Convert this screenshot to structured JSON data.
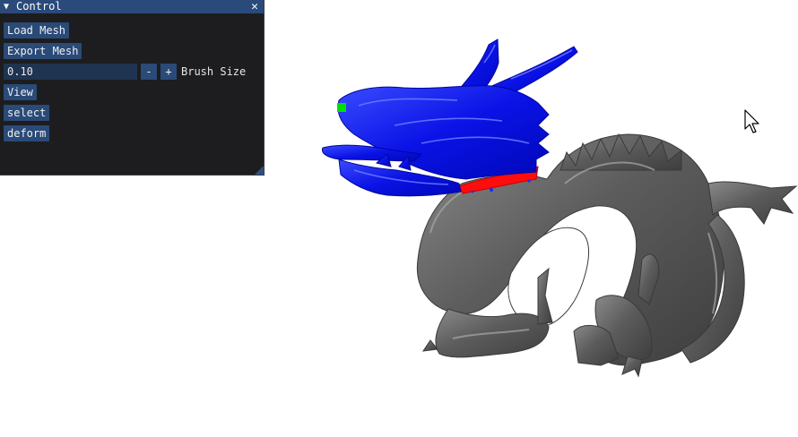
{
  "window": {
    "title": "Control",
    "collapse_icon": "triangle-down-icon",
    "close_icon": "close-icon"
  },
  "buttons": {
    "load_mesh": "Load Mesh",
    "export_mesh": "Export Mesh",
    "view": "View",
    "select": "select",
    "deform": "deform"
  },
  "brush": {
    "value": "0.10",
    "minus": "-",
    "plus": "+",
    "label": "Brush Size"
  },
  "scene": {
    "object": "dragon mesh",
    "colors": {
      "mesh": "#5e5e5e",
      "selected_region": "#0c10f0",
      "boundary": "#ff0d0d",
      "handle": "#00e000",
      "background": "#ffffff"
    }
  },
  "cursor_icon": "mouse-pointer-icon"
}
